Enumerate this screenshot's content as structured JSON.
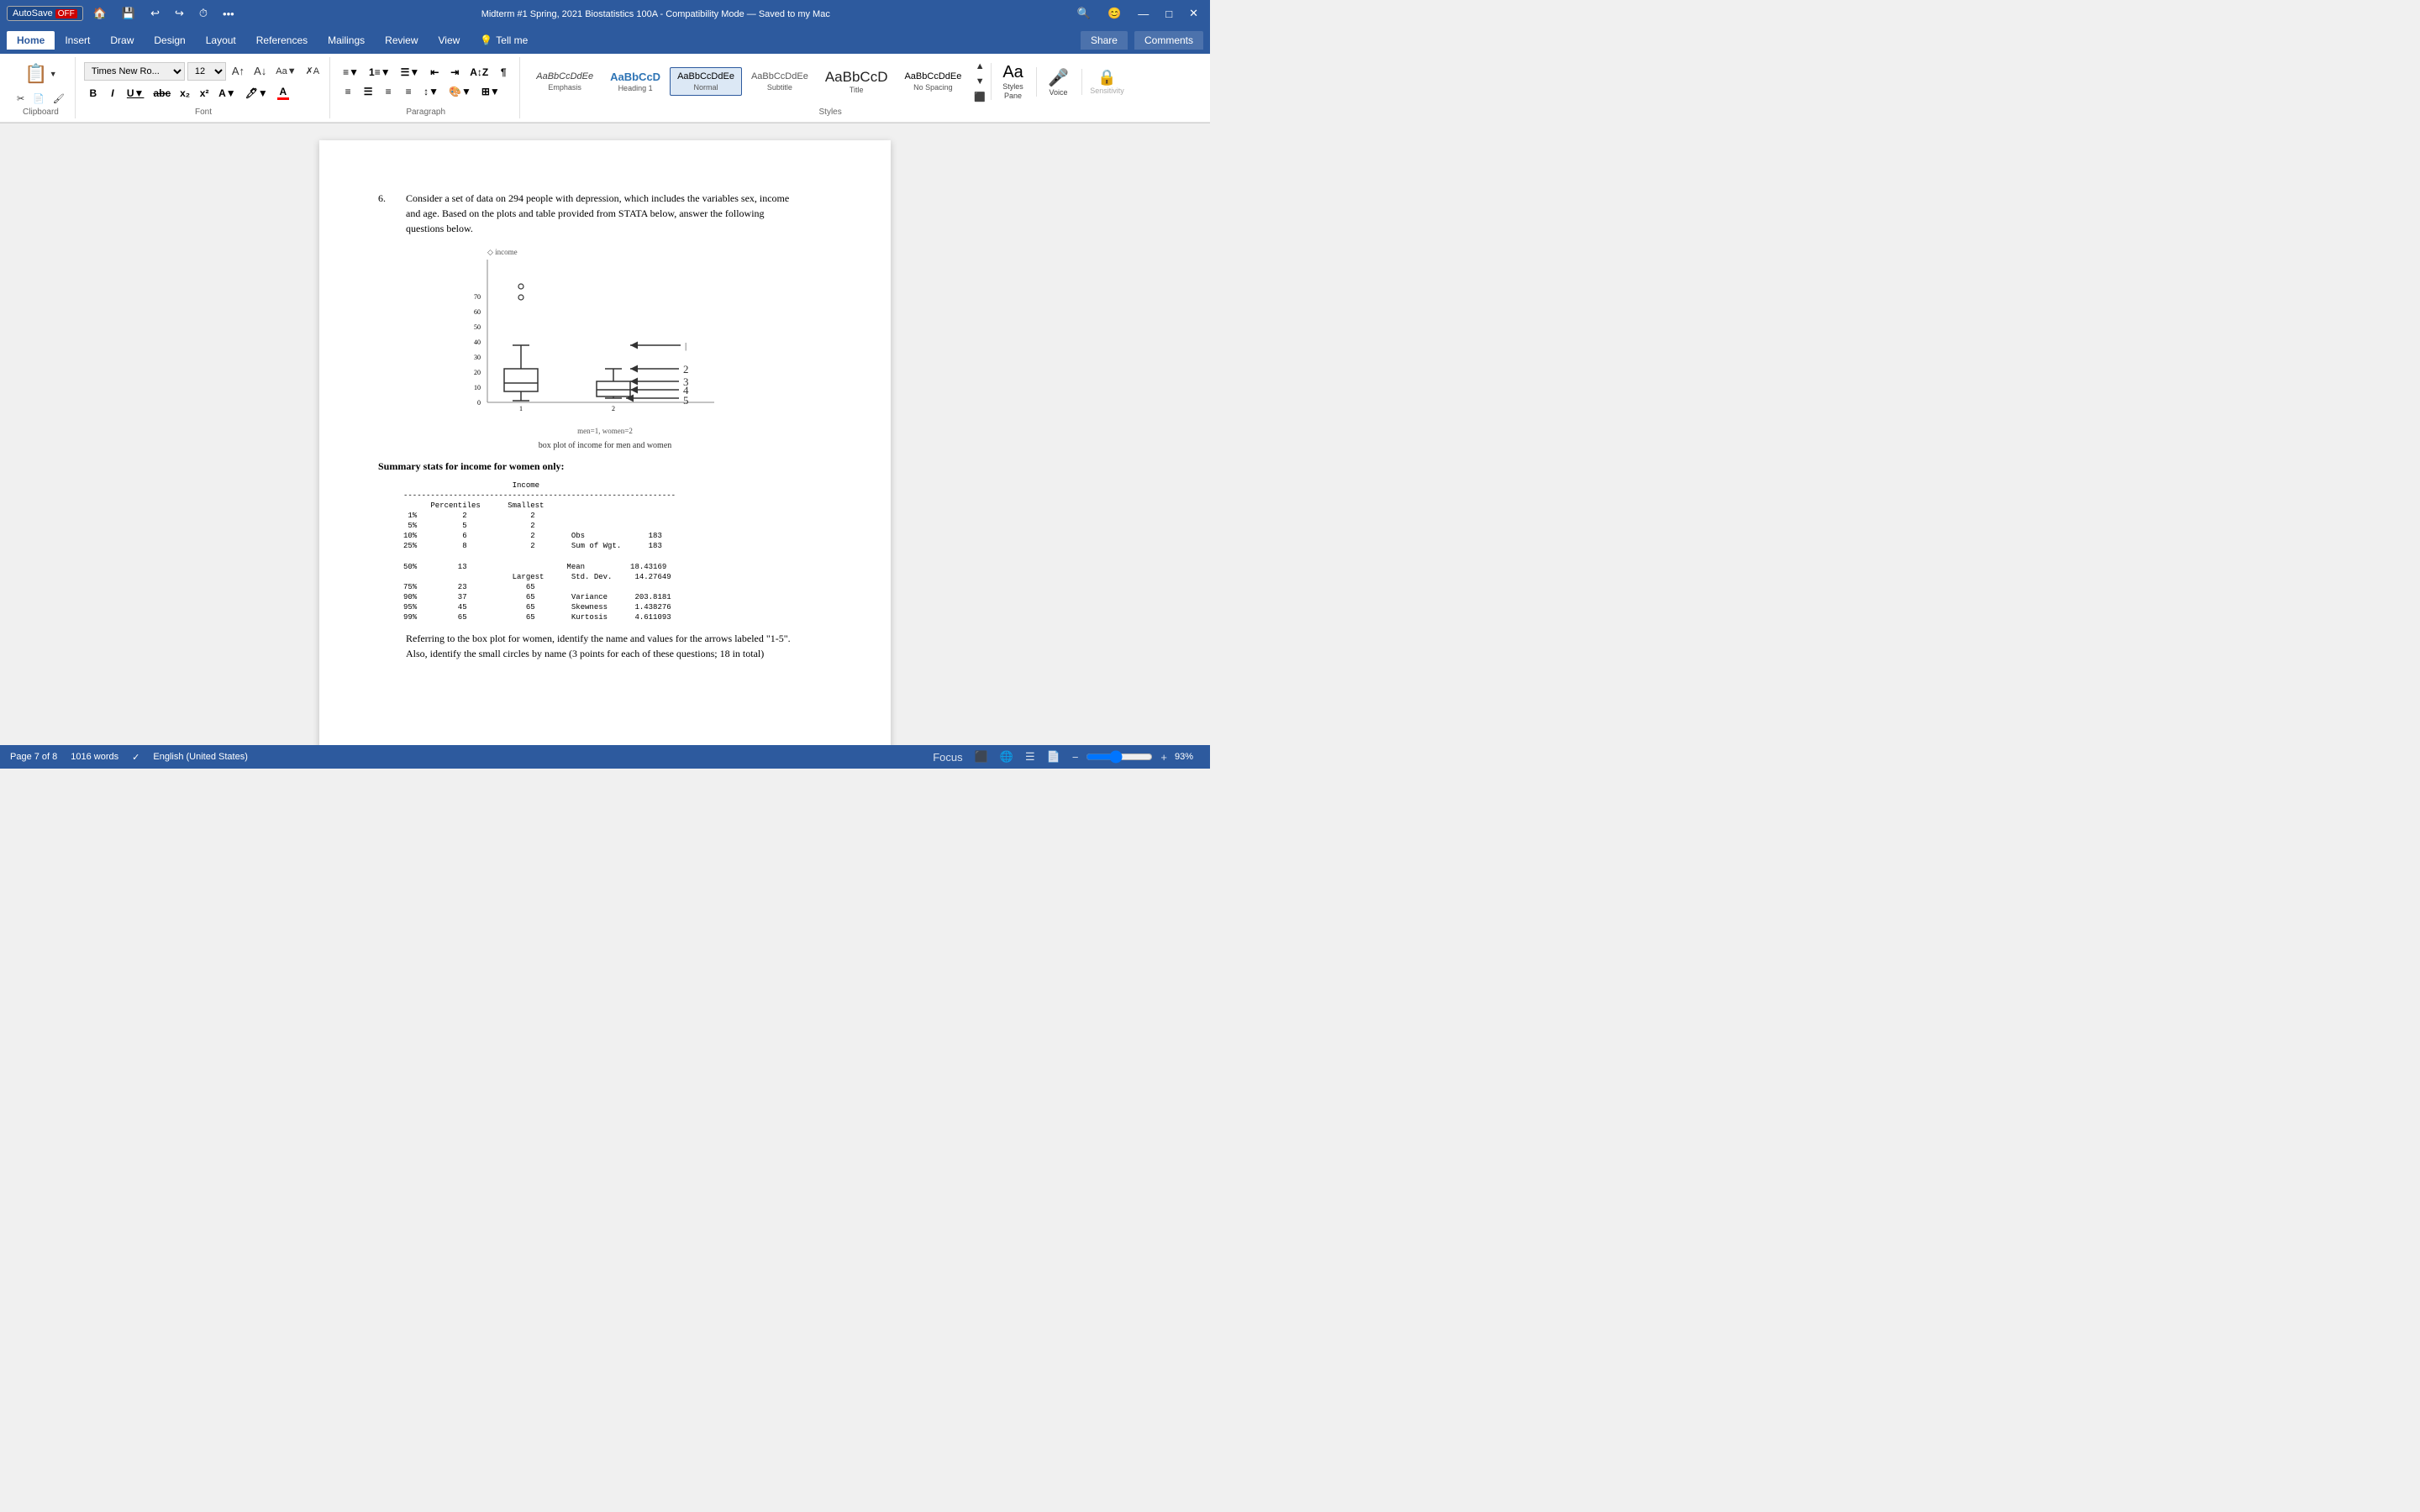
{
  "titlebar": {
    "autosave_label": "AutoSave",
    "autosave_state": "OFF",
    "save_icon": "💾",
    "undo_icon": "↩",
    "redo_icon": "↪",
    "history_icon": "⏱",
    "more_icon": "•••",
    "title": "Midterm #1 Spring, 2021 Biostatistics 100A  -  Compatibility Mode  —  Saved to my Mac",
    "search_icon": "🔍",
    "account_icon": "😊"
  },
  "tabs": {
    "items": [
      "Home",
      "Insert",
      "Draw",
      "Design",
      "Layout",
      "References",
      "Mailings",
      "Review",
      "View",
      "Tell me"
    ],
    "active": "Home"
  },
  "ribbon": {
    "paste_label": "Paste",
    "clipboard_label": "Clipboard",
    "font_name": "Times New Ro...",
    "font_size": "12",
    "font_label": "Font",
    "paragraph_label": "Paragraph",
    "styles_label": "Styles",
    "voice_label": "Voice",
    "sensitivity_label": "Sensitivity",
    "styles": [
      {
        "name": "Emphasis",
        "preview": "AaBbCcDdEe",
        "active": false
      },
      {
        "name": "Heading 1",
        "preview": "AaBbCcD",
        "active": false
      },
      {
        "name": "Normal",
        "preview": "AaBbCcDdEe",
        "active": true
      },
      {
        "name": "Subtitle",
        "preview": "AaBbCcDdEe",
        "active": false
      },
      {
        "name": "Title",
        "preview": "AaBbCcD",
        "active": false
      },
      {
        "name": "No Spacing",
        "preview": "AaBbCcDdEe",
        "active": false
      }
    ],
    "share_label": "Share",
    "comments_label": "Comments"
  },
  "document": {
    "question_number": "6.",
    "question_text": "Consider a set of data on 294 people with depression, which includes the variables sex, income and age. Based on the plots and table provided from STATA below, answer the following questions below.",
    "chart_caption": "box plot of income for men and women",
    "chart_legend": "income",
    "chart_x_label": "men=1, women=2",
    "stats_header": "Summary stats for income for women only:",
    "stats_data": "                        Income\n------------------------------------------------------------\n      Percentiles      Smallest\n 1%          2              2\n 5%          5              2\n10%          6              2        Obs              183\n25%          8              2        Sum of Wgt.      183\n\n50%         13                      Mean          18.43169\n                        Largest      Std. Dev.     14.27649\n75%         23             65\n90%         37             65        Variance      203.8181\n95%         45             65        Skewness      1.438276\n99%         65             65        Kurtosis      4.611093",
    "question_part": "Referring to the box plot for women, identify the name and values for the arrows labeled \"1-5\". Also, identify the small circles by name (3 points for each of these questions; 18 in total)"
  },
  "statusbar": {
    "page_label": "Page 7 of 8",
    "words_label": "1016 words",
    "spell_icon": "✓",
    "language": "English (United States)",
    "focus_label": "Focus",
    "zoom_level": "93%"
  }
}
